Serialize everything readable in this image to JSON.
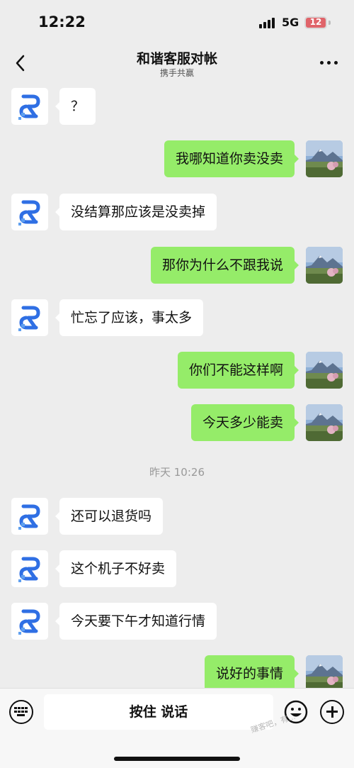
{
  "status_bar": {
    "time": "12:22",
    "network": "5G",
    "battery": "12",
    "battery_color": "#e0646a"
  },
  "nav": {
    "title": "和谐客服对帐",
    "subtitle": "携手共赢",
    "back_icon": "chevron-left-icon",
    "more_icon": "more-dots-icon"
  },
  "messages": [
    {
      "side": "in",
      "text": "？"
    },
    {
      "side": "out",
      "text": "我哪知道你卖没卖"
    },
    {
      "side": "in",
      "text": "没结算那应该是没卖掉"
    },
    {
      "side": "out",
      "text": "那你为什么不跟我说"
    },
    {
      "side": "in",
      "text": "忙忘了应该，事太多"
    },
    {
      "side": "out",
      "text": "你们不能这样啊"
    },
    {
      "side": "out",
      "text": "今天多少能卖"
    },
    {
      "side": "in",
      "text": "还可以退货吗"
    },
    {
      "side": "in",
      "text": "这个机子不好卖"
    },
    {
      "side": "in",
      "text": "今天要下午才知道行情"
    },
    {
      "side": "out",
      "text": "说好的事情"
    }
  ],
  "time_divider": "昨天 10:26",
  "input_bar": {
    "talk_label": "按住 说话",
    "keyboard_icon": "keyboard-icon",
    "emoji_icon": "emoji-icon",
    "plus_icon": "plus-icon"
  },
  "colors": {
    "outgoing_bubble": "#95ec69",
    "incoming_bubble": "#ffffff",
    "background": "#ededed"
  },
  "watermark": "赚客吧，有..."
}
